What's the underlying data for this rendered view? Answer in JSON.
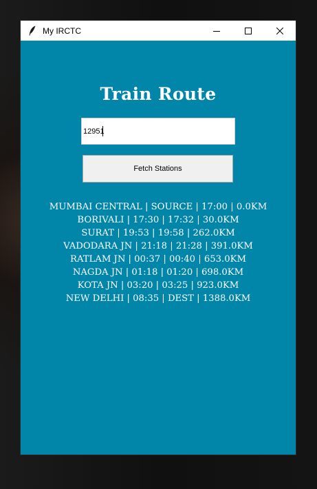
{
  "window": {
    "title": "My IRCTC",
    "icon": "feather-icon",
    "controls": [
      "minimize-icon",
      "maximize-icon",
      "close-icon"
    ]
  },
  "page": {
    "heading": "Train Route",
    "train_input_value": "12951",
    "fetch_button_label": "Fetch Stations"
  },
  "stations": [
    "MUMBAI CENTRAL  |  SOURCE  |  17:00  |  0.0KM",
    "BORIVALI  |  17:30  |  17:32  |  30.0KM",
    "SURAT  |  19:53  |  19:58  |  262.0KM",
    "VADODARA JN  |  21:18  |  21:28  |  391.0KM",
    "RATLAM JN  |  00:37  |  00:40  |  653.0KM",
    "NAGDA JN  |  01:18  |  01:20  |  698.0KM",
    "KOTA JN  |  03:20  |  03:25  |  923.0KM",
    "NEW DELHI  |  08:35  |  DEST  |  1388.0KM"
  ],
  "colors": {
    "window_background": "#0186aa",
    "text": "#ffffff",
    "button_background": "#f0f0f0"
  }
}
